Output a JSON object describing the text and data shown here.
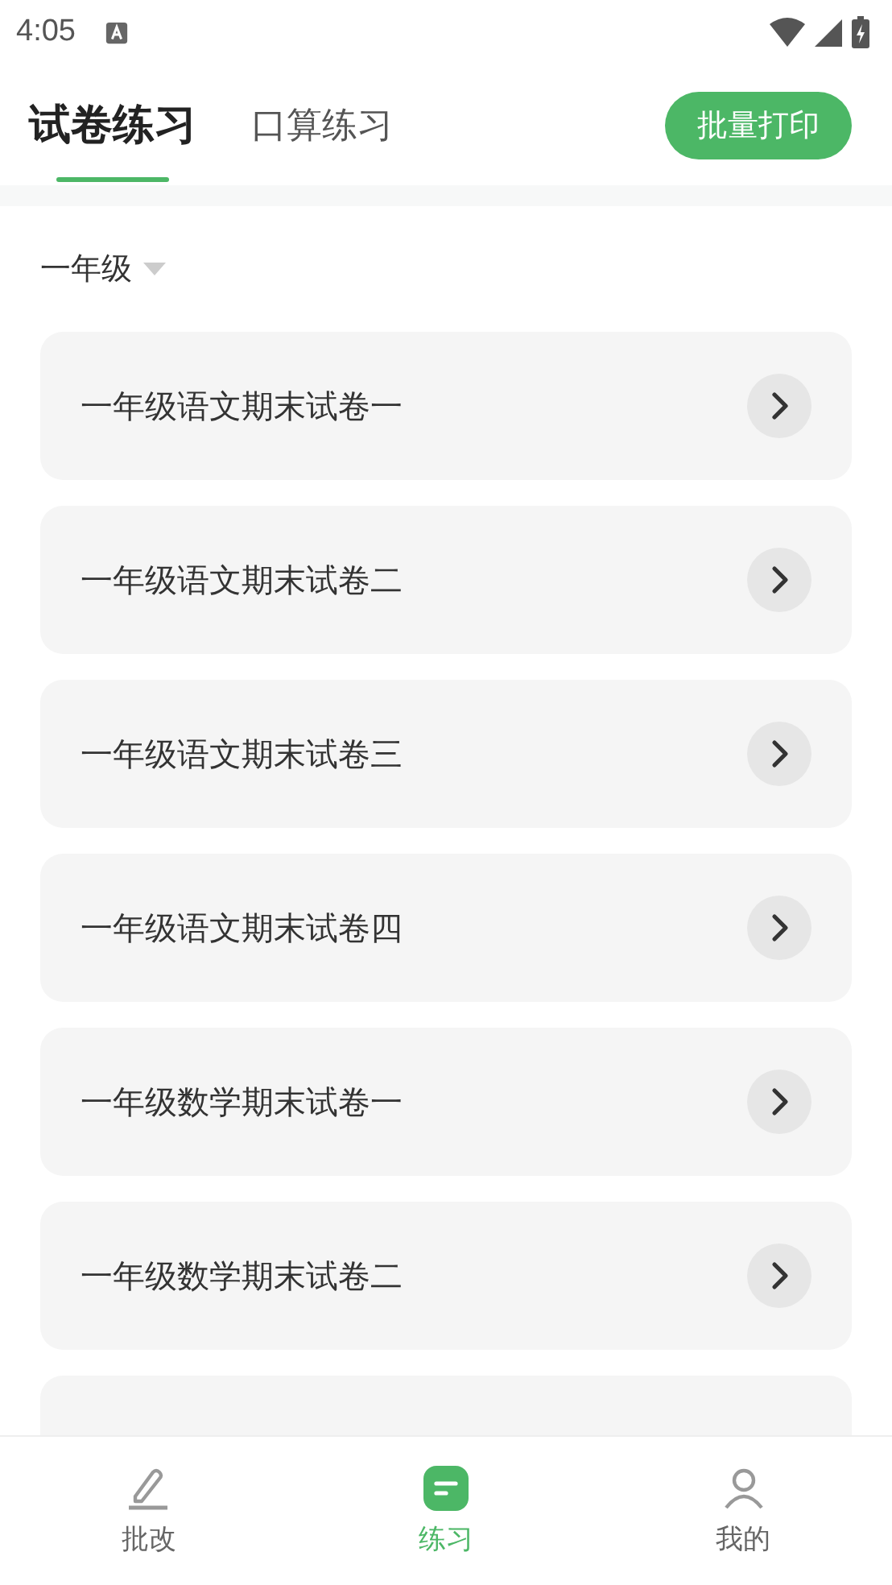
{
  "status_bar": {
    "time": "4:05"
  },
  "tabs": [
    {
      "label": "试卷练习",
      "selected": true
    },
    {
      "label": "口算练习",
      "selected": false
    }
  ],
  "print_button": "批量打印",
  "grade_filter": "一年级",
  "papers": [
    {
      "title": "一年级语文期末试卷一"
    },
    {
      "title": "一年级语文期末试卷二"
    },
    {
      "title": "一年级语文期末试卷三"
    },
    {
      "title": "一年级语文期末试卷四"
    },
    {
      "title": "一年级数学期末试卷一"
    },
    {
      "title": "一年级数学期末试卷二"
    },
    {
      "kind": "partial"
    }
  ],
  "bottom_nav": [
    {
      "label": "批改",
      "kind": "pen",
      "selected": false
    },
    {
      "label": "练习",
      "kind": "practice",
      "selected": true
    },
    {
      "label": "我的",
      "kind": "user",
      "selected": false
    }
  ]
}
